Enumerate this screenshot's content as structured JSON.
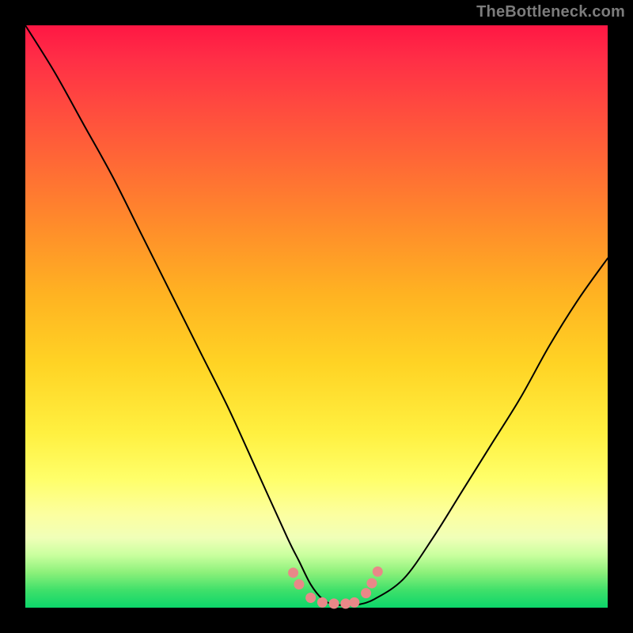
{
  "watermark": "TheBottleneck.com",
  "chart_data": {
    "type": "line",
    "title": "",
    "xlabel": "",
    "ylabel": "",
    "xlim": [
      0,
      100
    ],
    "ylim": [
      0,
      100
    ],
    "series": [
      {
        "name": "bottleneck-curve",
        "x": [
          0,
          5,
          10,
          15,
          20,
          25,
          30,
          35,
          40,
          45,
          47,
          49,
          51,
          53,
          55,
          57,
          60,
          65,
          70,
          75,
          80,
          85,
          90,
          95,
          100
        ],
        "values": [
          100,
          92,
          83,
          74,
          64,
          54,
          44,
          34,
          23,
          12,
          8,
          4,
          1.5,
          0.5,
          0.5,
          0.5,
          1.5,
          5,
          12,
          20,
          28,
          36,
          45,
          53,
          60
        ]
      }
    ],
    "markers": {
      "name": "highlight-dots",
      "color": "#e98888",
      "points_x": [
        46,
        47,
        49,
        51,
        53,
        55,
        56.5,
        58.5,
        59.5,
        60.5
      ],
      "points_y": [
        6,
        4,
        1.7,
        0.9,
        0.7,
        0.7,
        0.9,
        2.5,
        4.2,
        6.2
      ]
    },
    "gradient_stops": [
      {
        "pos": 0.0,
        "color": "#ff1744"
      },
      {
        "pos": 0.06,
        "color": "#ff2f46"
      },
      {
        "pos": 0.14,
        "color": "#ff4a3f"
      },
      {
        "pos": 0.24,
        "color": "#ff6a35"
      },
      {
        "pos": 0.35,
        "color": "#ff8e2a"
      },
      {
        "pos": 0.46,
        "color": "#ffb222"
      },
      {
        "pos": 0.58,
        "color": "#ffd324"
      },
      {
        "pos": 0.7,
        "color": "#fff040"
      },
      {
        "pos": 0.78,
        "color": "#ffff6a"
      },
      {
        "pos": 0.84,
        "color": "#fcffa0"
      },
      {
        "pos": 0.88,
        "color": "#f0ffb8"
      },
      {
        "pos": 0.91,
        "color": "#c9ff9e"
      },
      {
        "pos": 0.94,
        "color": "#8bf07a"
      },
      {
        "pos": 0.97,
        "color": "#3fe06a"
      },
      {
        "pos": 1.0,
        "color": "#0cd66a"
      }
    ]
  }
}
